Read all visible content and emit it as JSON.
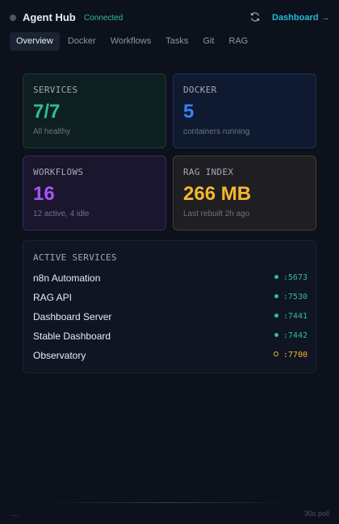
{
  "header": {
    "title": "Agent Hub",
    "connection": "Connected",
    "refresh_icon": "refresh-icon",
    "dashboard_link": "Dashboard →"
  },
  "tabs": [
    {
      "label": "Overview",
      "active": true
    },
    {
      "label": "Docker",
      "active": false
    },
    {
      "label": "Workflows",
      "active": false
    },
    {
      "label": "Tasks",
      "active": false
    },
    {
      "label": "Git",
      "active": false
    },
    {
      "label": "RAG",
      "active": false
    }
  ],
  "cards": {
    "services": {
      "label": "SERVICES",
      "value": "7/7",
      "sub": "All healthy",
      "color": "#2fbf8f"
    },
    "docker": {
      "label": "DOCKER",
      "value": "5",
      "sub": "containers running",
      "color": "#3b82f6"
    },
    "workflows": {
      "label": "WORKFLOWS",
      "value": "16",
      "sub": "12 active, 4 idle",
      "color": "#a855f7"
    },
    "rag": {
      "label": "RAG INDEX",
      "value": "266 MB",
      "sub": "Last rebuilt 2h ago",
      "color": "#f5b82e"
    }
  },
  "active_services": {
    "title": "ACTIVE SERVICES",
    "items": [
      {
        "name": "n8n Automation",
        "port": ":5673",
        "status": "ok"
      },
      {
        "name": "RAG API",
        "port": ":7530",
        "status": "ok"
      },
      {
        "name": "Dashboard Server",
        "port": ":7441",
        "status": "ok"
      },
      {
        "name": "Stable Dashboard",
        "port": ":7442",
        "status": "ok"
      },
      {
        "name": "Observatory",
        "port": ":7700",
        "status": "warn"
      }
    ]
  },
  "footer": {
    "dots": "...",
    "poll": "30s poll"
  },
  "colors": {
    "status_ok": "#2fbf8f",
    "status_warn": "#f5b82e",
    "accent_link": "#22b8d8"
  }
}
